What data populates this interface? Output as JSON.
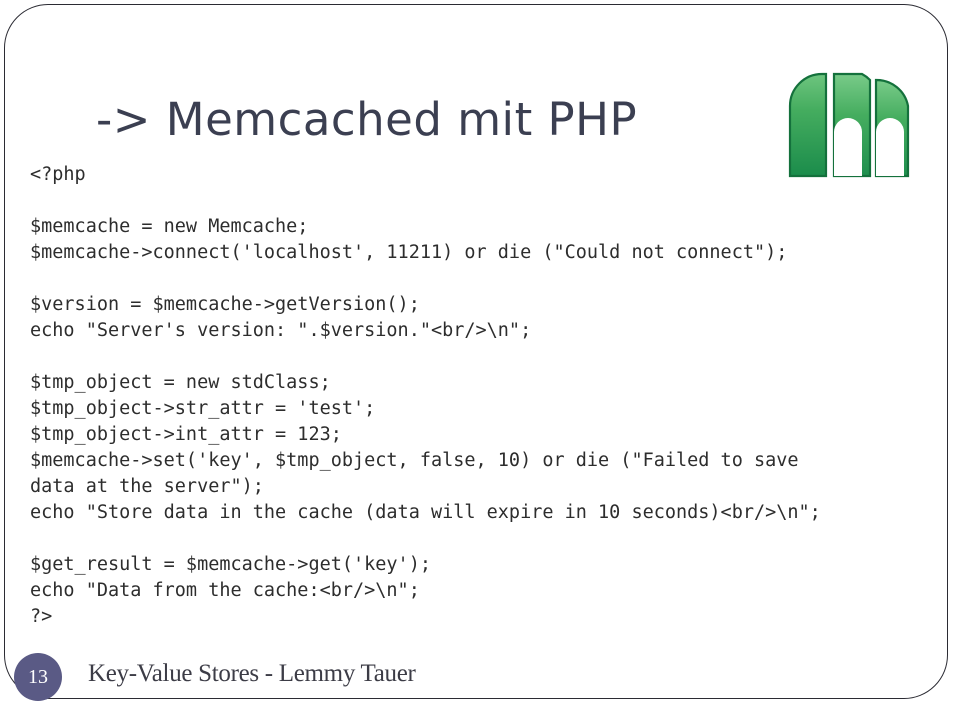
{
  "slide": {
    "title": "-> Memcached mit PHP",
    "logo": {
      "name": "memcached-logo",
      "alt": "memcached logo",
      "color_light": "#57ba6b",
      "color_dark": "#1b8c4b",
      "outline": "#14713c"
    },
    "code": {
      "language": "php",
      "lines": [
        "<?php",
        "",
        "$memcache = new Memcache;",
        "$memcache->connect('localhost', 11211) or die (\"Could not connect\");",
        "",
        "$version = $memcache->getVersion();",
        "echo \"Server's version: \".$version.\"<br/>\\n\";",
        "",
        "$tmp_object = new stdClass;",
        "$tmp_object->str_attr = 'test';",
        "$tmp_object->int_attr = 123;",
        "$memcache->set('key', $tmp_object, false, 10) or die (\"Failed to save",
        "data at the server\");",
        "echo \"Store data in the cache (data will expire in 10 seconds)<br/>\\n\";",
        "",
        "$get_result = $memcache->get('key');",
        "echo \"Data from the cache:<br/>\\n\";",
        "?>"
      ]
    },
    "footer": {
      "slide_number": "13",
      "title": "Key-Value Stores - Lemmy Tauer",
      "badge_color": "#5a5a85"
    }
  }
}
